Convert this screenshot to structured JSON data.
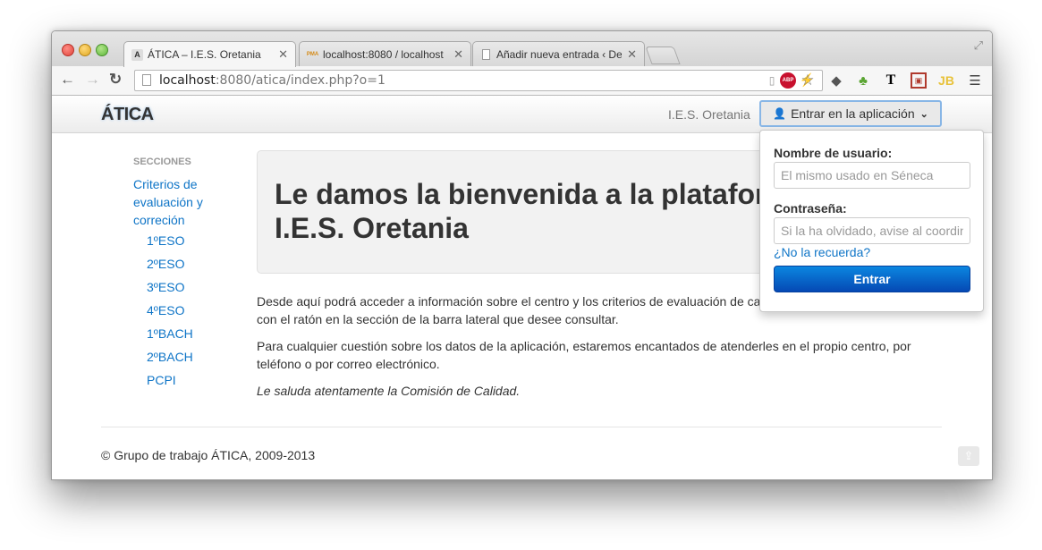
{
  "browser": {
    "tabs": [
      {
        "title": "ÁTICA – I.E.S. Oretania",
        "favicon": "A"
      },
      {
        "title": "localhost:8080 / localhost",
        "favicon": "PMA"
      },
      {
        "title": "Añadir nueva entrada ‹ Des",
        "favicon": ""
      }
    ],
    "url_host": "localhost",
    "url_path": ":8080/atica/index.php?o=1"
  },
  "header": {
    "brand": "ÁTICA",
    "school": "I.E.S. Oretania",
    "login_button": "Entrar en la aplicación"
  },
  "login": {
    "username_label": "Nombre de usuario:",
    "username_placeholder": "El mismo usado en Séneca",
    "password_label": "Contraseña:",
    "password_placeholder": "Si la ha olvidado, avise al coordinador",
    "forgot_link": "¿No la recuerda?",
    "submit": "Entrar"
  },
  "sidebar": {
    "heading": "SECCIONES",
    "main_link": "Criterios de evaluación y correción",
    "items": [
      "1ºESO",
      "2ºESO",
      "3ºESO",
      "4ºESO",
      "1ºBACH",
      "2ºBACH",
      "PCPI"
    ]
  },
  "main": {
    "title_line1": "Le damos la bienvenida a la plataforma del",
    "title_line2": "I.E.S. Oretania",
    "p1": "Desde aquí podrá acceder a información sobre el centro y los criterios de evaluación de cada departamento. Haga clic con el ratón en la sección de la barra lateral que desee consultar.",
    "p2": "Para cualquier cuestión sobre los datos de la aplicación, estaremos encantados de atenderles en el propio centro, por teléfono o por correo electrónico.",
    "sign": "Le saluda atentamente la Comisión de Calidad."
  },
  "footer": {
    "text": "© Grupo de trabajo ÁTICA, 2009-2013"
  }
}
